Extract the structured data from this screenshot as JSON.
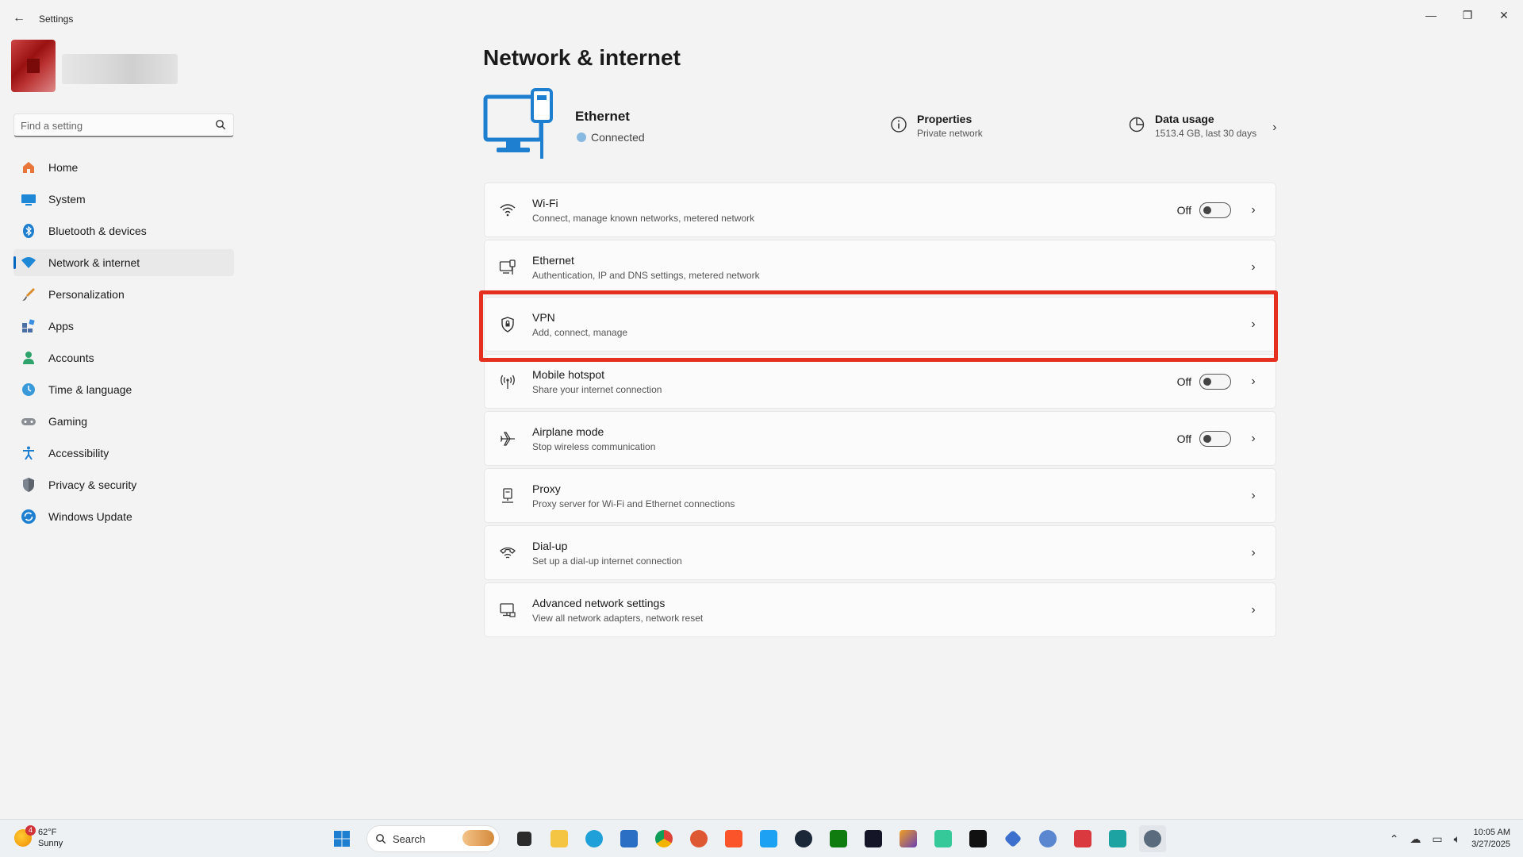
{
  "window": {
    "title": "Settings",
    "back_glyph": "←",
    "minimize_glyph": "—",
    "maximize_glyph": "❐",
    "close_glyph": "✕"
  },
  "search": {
    "placeholder": "Find a setting",
    "icon": "search-icon"
  },
  "sidebar": {
    "items": [
      {
        "label": "Home",
        "icon": "home-icon",
        "active": false
      },
      {
        "label": "System",
        "icon": "system-icon",
        "active": false
      },
      {
        "label": "Bluetooth & devices",
        "icon": "bluetooth-icon",
        "active": false
      },
      {
        "label": "Network & internet",
        "icon": "network-icon",
        "active": true
      },
      {
        "label": "Personalization",
        "icon": "brush-icon",
        "active": false
      },
      {
        "label": "Apps",
        "icon": "apps-icon",
        "active": false
      },
      {
        "label": "Accounts",
        "icon": "accounts-icon",
        "active": false
      },
      {
        "label": "Time & language",
        "icon": "time-language-icon",
        "active": false
      },
      {
        "label": "Gaming",
        "icon": "gaming-icon",
        "active": false
      },
      {
        "label": "Accessibility",
        "icon": "accessibility-icon",
        "active": false
      },
      {
        "label": "Privacy & security",
        "icon": "shield-icon",
        "active": false
      },
      {
        "label": "Windows Update",
        "icon": "update-icon",
        "active": false
      }
    ]
  },
  "main": {
    "title": "Network & internet",
    "hero": {
      "name": "Ethernet",
      "status": "Connected",
      "properties_title": "Properties",
      "properties_sub": "Private network",
      "data_title": "Data usage",
      "data_sub": "1513.4 GB, last 30 days"
    },
    "cards": [
      {
        "title": "Wi-Fi",
        "sub": "Connect, manage known networks, metered network",
        "icon": "wifi-icon",
        "toggle": "Off"
      },
      {
        "title": "Ethernet",
        "sub": "Authentication, IP and DNS settings, metered network",
        "icon": "ethernet-icon",
        "toggle": null
      },
      {
        "title": "VPN",
        "sub": "Add, connect, manage",
        "icon": "vpn-shield-icon",
        "toggle": null
      },
      {
        "title": "Mobile hotspot",
        "sub": "Share your internet connection",
        "icon": "hotspot-icon",
        "toggle": "Off"
      },
      {
        "title": "Airplane mode",
        "sub": "Stop wireless communication",
        "icon": "airplane-icon",
        "toggle": "Off"
      },
      {
        "title": "Proxy",
        "sub": "Proxy server for Wi-Fi and Ethernet connections",
        "icon": "proxy-icon",
        "toggle": null
      },
      {
        "title": "Dial-up",
        "sub": "Set up a dial-up internet connection",
        "icon": "dialup-icon",
        "toggle": null
      },
      {
        "title": "Advanced network settings",
        "sub": "View all network adapters, network reset",
        "icon": "advanced-network-icon",
        "toggle": null
      }
    ],
    "highlight_color": "#e53020"
  },
  "taskbar": {
    "weather_temp": "62°F",
    "weather_desc": "Sunny",
    "weather_badge": "4",
    "search_label": "Search",
    "time": "10:05 AM",
    "date": "3/27/2025"
  },
  "colors": {
    "accent": "#0067c0",
    "window_bg": "#f3f3f3",
    "card_bg": "#fbfbfb"
  }
}
